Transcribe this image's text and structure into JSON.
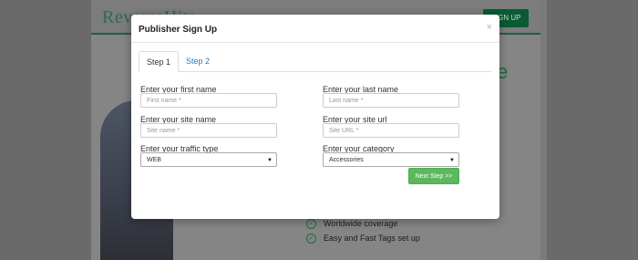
{
  "background": {
    "logo_text": "ReverseHits",
    "signup_label": "SIGN UP",
    "hero_partial_text": "e",
    "features": [
      {
        "label": "Worldwide coverage"
      },
      {
        "label": "Easy and Fast Tags set up"
      }
    ]
  },
  "modal": {
    "title": "Publisher Sign Up",
    "close_glyph": "×",
    "tabs": [
      {
        "label": "Step 1",
        "active": true
      },
      {
        "label": "Step 2",
        "active": false
      }
    ],
    "fields": {
      "first_name": {
        "label": "Enter your first name",
        "placeholder": "First name *"
      },
      "last_name": {
        "label": "Enter your last name",
        "placeholder": "Last name *"
      },
      "site_name": {
        "label": "Enter your site name",
        "placeholder": "Site name *"
      },
      "site_url": {
        "label": "Enter your site url",
        "placeholder": "Site URL *"
      },
      "traffic_type": {
        "label": "Enter your traffic type",
        "value": "WEB"
      },
      "category": {
        "label": "Enter your category",
        "value": "Accessories"
      }
    },
    "next_label": "Next Step >>"
  },
  "icons": {
    "select_arrow": "▼",
    "check": "✓"
  },
  "colors": {
    "accent_green": "#5cb85c",
    "tab_link": "#337ab7",
    "brand_green": "#0a5a34"
  }
}
